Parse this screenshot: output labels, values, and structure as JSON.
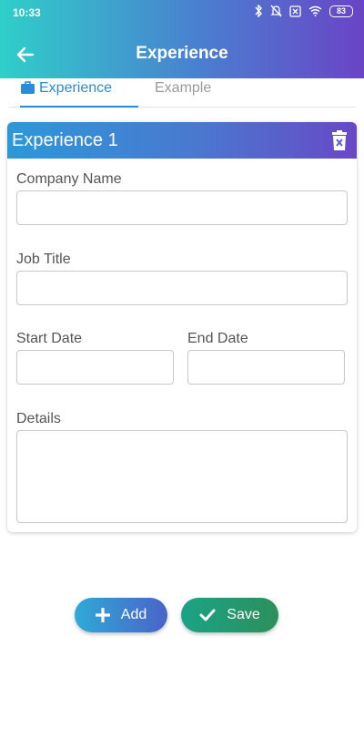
{
  "status_bar": {
    "time": "10:33",
    "battery": "83"
  },
  "header": {
    "title": "Experience"
  },
  "tabs": [
    {
      "label": "Experience",
      "active": true
    },
    {
      "label": "Example",
      "active": false
    }
  ],
  "card": {
    "title": "Experience 1",
    "fields": {
      "company_name": {
        "label": "Company Name",
        "value": ""
      },
      "job_title": {
        "label": "Job Title",
        "value": ""
      },
      "start_date": {
        "label": "Start Date",
        "value": ""
      },
      "end_date": {
        "label": "End Date",
        "value": ""
      },
      "details": {
        "label": "Details",
        "value": ""
      }
    }
  },
  "buttons": {
    "add": "Add",
    "save": "Save"
  },
  "colors": {
    "header_start": "#2fcfc9",
    "header_end": "#6a44c6",
    "tab_active": "#2b8bd6",
    "add_button": "#3a86cf",
    "save_button": "#1e9a72"
  }
}
